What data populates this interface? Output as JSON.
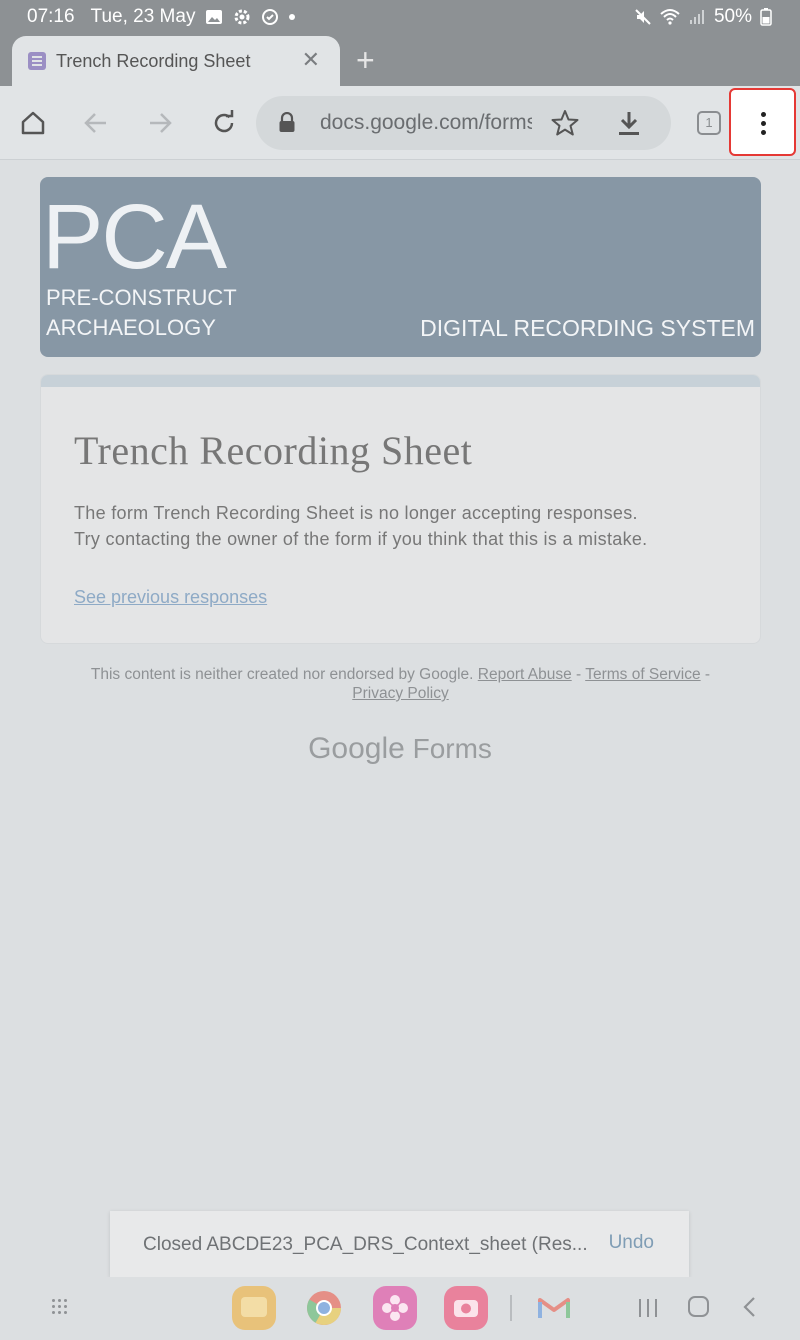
{
  "status_bar": {
    "time": "07:16",
    "date": "Tue, 23 May",
    "battery": "50%"
  },
  "tab": {
    "title": "Trench Recording Sheet",
    "close": "✕",
    "new_tab": "+"
  },
  "toolbar": {
    "url": "docs.google.com/forms",
    "tab_count": "1"
  },
  "banner": {
    "logo": "PCA",
    "subtitle_line1": "PRE-CONSTRUCT",
    "subtitle_line2": "ARCHAEOLOGY",
    "system": "DIGITAL RECORDING SYSTEM"
  },
  "form_card": {
    "title": "Trench Recording Sheet",
    "message_line1": "The form Trench Recording Sheet is no longer accepting responses.",
    "message_line2": "Try contacting the owner of the form if you think that this is a mistake.",
    "link": "See previous responses"
  },
  "footer": {
    "disclaimer": "This content is neither created nor endorsed by Google.",
    "report_abuse": "Report Abuse",
    "sep1": " - ",
    "terms": "Terms of Service",
    "sep2": " -",
    "privacy": "Privacy Policy",
    "brand_google": "Google",
    "brand_forms": "Forms"
  },
  "snackbar": {
    "message": "Closed ABCDE23_PCA_DRS_Context_sheet (Res...",
    "action": "Undo"
  },
  "colors": {
    "highlight": "#e53935",
    "banner": "#8797a5",
    "link": "#8eaac6"
  },
  "icons": {
    "home": "home-icon",
    "back": "arrow-back-icon",
    "forward": "arrow-forward-icon",
    "reload": "reload-icon",
    "lock": "lock-icon",
    "bookmark": "star-icon",
    "download": "download-icon",
    "menu": "more-vert-icon"
  }
}
